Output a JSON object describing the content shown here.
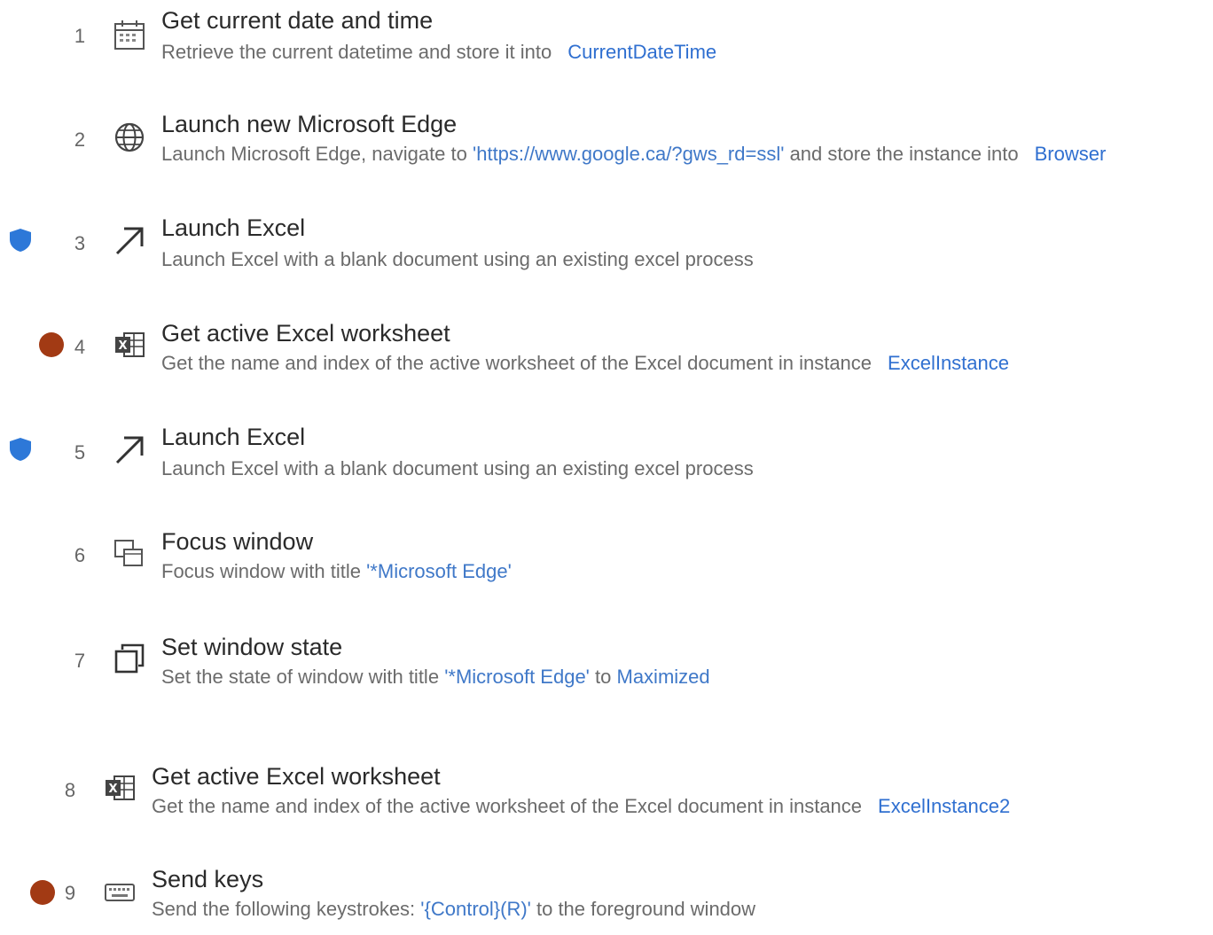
{
  "colors": {
    "breakpoint": "#a23a14",
    "shield": "#2d78d8",
    "link": "#2f6fd0",
    "title": "#2a2a2a",
    "description": "#6b6b6b"
  },
  "steps": [
    {
      "number": "1",
      "icon": "calendar-icon",
      "title": "Get current date and time",
      "desc_prefix": "Retrieve the current datetime and store it into",
      "variable": "CurrentDateTime"
    },
    {
      "number": "2",
      "icon": "globe-icon",
      "title": "Launch new Microsoft Edge",
      "desc_prefix": "Launch Microsoft Edge, navigate to",
      "literal": "'https://www.google.ca/?gws_rd=ssl'",
      "desc_mid": "and store the instance into",
      "variable": "Browser"
    },
    {
      "number": "3",
      "icon": "arrow-up-right-icon",
      "marker": "shield",
      "title": "Launch Excel",
      "desc_prefix": "Launch Excel with a blank document using an existing excel process"
    },
    {
      "number": "4",
      "icon": "excel-sheet-icon",
      "marker": "breakpoint",
      "title": "Get active Excel worksheet",
      "desc_prefix": "Get the name and index of the active worksheet of the Excel document in instance",
      "variable": "ExcelInstance"
    },
    {
      "number": "5",
      "icon": "arrow-up-right-icon",
      "marker": "shield",
      "title": "Launch Excel",
      "desc_prefix": "Launch Excel with a blank document using an existing excel process"
    },
    {
      "number": "6",
      "icon": "focus-window-icon",
      "title": "Focus window",
      "desc_prefix": "Focus window with title",
      "literal": "'*Microsoft Edge'"
    },
    {
      "number": "7",
      "icon": "window-state-icon",
      "title": "Set window state",
      "desc_prefix": "Set the state of window with title",
      "literal": "'*Microsoft Edge'",
      "desc_mid": "to",
      "literal2": "Maximized"
    },
    {
      "number": "8",
      "icon": "excel-sheet-icon",
      "title": "Get active Excel worksheet",
      "desc_prefix": "Get the name and index of the active worksheet of the Excel document in instance",
      "variable": "ExcelInstance2"
    },
    {
      "number": "9",
      "icon": "keyboard-icon",
      "marker": "breakpoint",
      "title": "Send keys",
      "desc_prefix": "Send the following keystrokes:",
      "literal": "'{Control}(R)'",
      "desc_mid": "to the foreground window"
    }
  ]
}
